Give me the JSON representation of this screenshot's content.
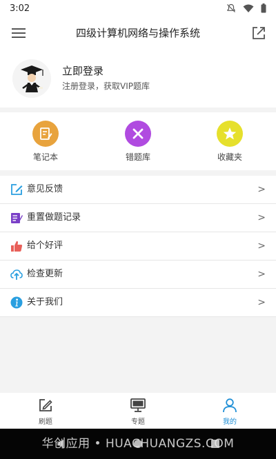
{
  "status": {
    "time": "3:02"
  },
  "header": {
    "title": "四级计算机网络与操作系统"
  },
  "profile": {
    "login": "立即登录",
    "subtitle": "注册登录，获取VIP题库"
  },
  "quick_actions": [
    {
      "label": "笔记本",
      "icon": "notebook-icon",
      "color": "#e8a33d"
    },
    {
      "label": "错题库",
      "icon": "wrong-questions-icon",
      "color": "#b04be0"
    },
    {
      "label": "收藏夹",
      "icon": "favorites-star-icon",
      "color": "#e6e02c"
    }
  ],
  "menu": [
    {
      "label": "意见反馈",
      "chevron": ">",
      "icon": "feedback-edit-icon"
    },
    {
      "label": "重置做题记录",
      "chevron": ">",
      "icon": "reset-record-icon"
    },
    {
      "label": "给个好评",
      "chevron": ">",
      "icon": "thumbs-up-icon"
    },
    {
      "label": "检查更新",
      "chevron": ">",
      "icon": "cloud-upload-icon"
    },
    {
      "label": "关于我们",
      "chevron": ">",
      "icon": "info-icon"
    }
  ],
  "bottom_nav": [
    {
      "label": "刷题",
      "icon": "edit-icon",
      "active": false
    },
    {
      "label": "专题",
      "icon": "monitor-icon",
      "active": false
    },
    {
      "label": "我的",
      "icon": "user-icon",
      "active": true
    }
  ],
  "watermark": "华创应用 • HUACHUANGZS.COM",
  "colors": {
    "accent": "#1f8fd6"
  }
}
